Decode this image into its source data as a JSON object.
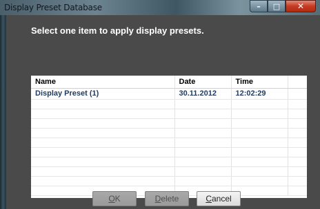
{
  "window": {
    "title": "Display Preset Database",
    "caption_buttons": {
      "minimize": "–",
      "maximize": "□",
      "close": "✕"
    }
  },
  "instruction": "Select one item to apply display presets.",
  "table": {
    "columns": [
      "Name",
      "Date",
      "Time",
      ""
    ],
    "rows": [
      [
        "Display Preset (1)",
        "30.11.2012",
        "12:02:29",
        ""
      ]
    ],
    "empty_rows": 10
  },
  "buttons": {
    "ok": {
      "accel": "O",
      "rest": "K"
    },
    "delete": {
      "accel": "D",
      "rest": "elete"
    },
    "cancel": {
      "accel": "C",
      "rest": "ancel"
    }
  }
}
